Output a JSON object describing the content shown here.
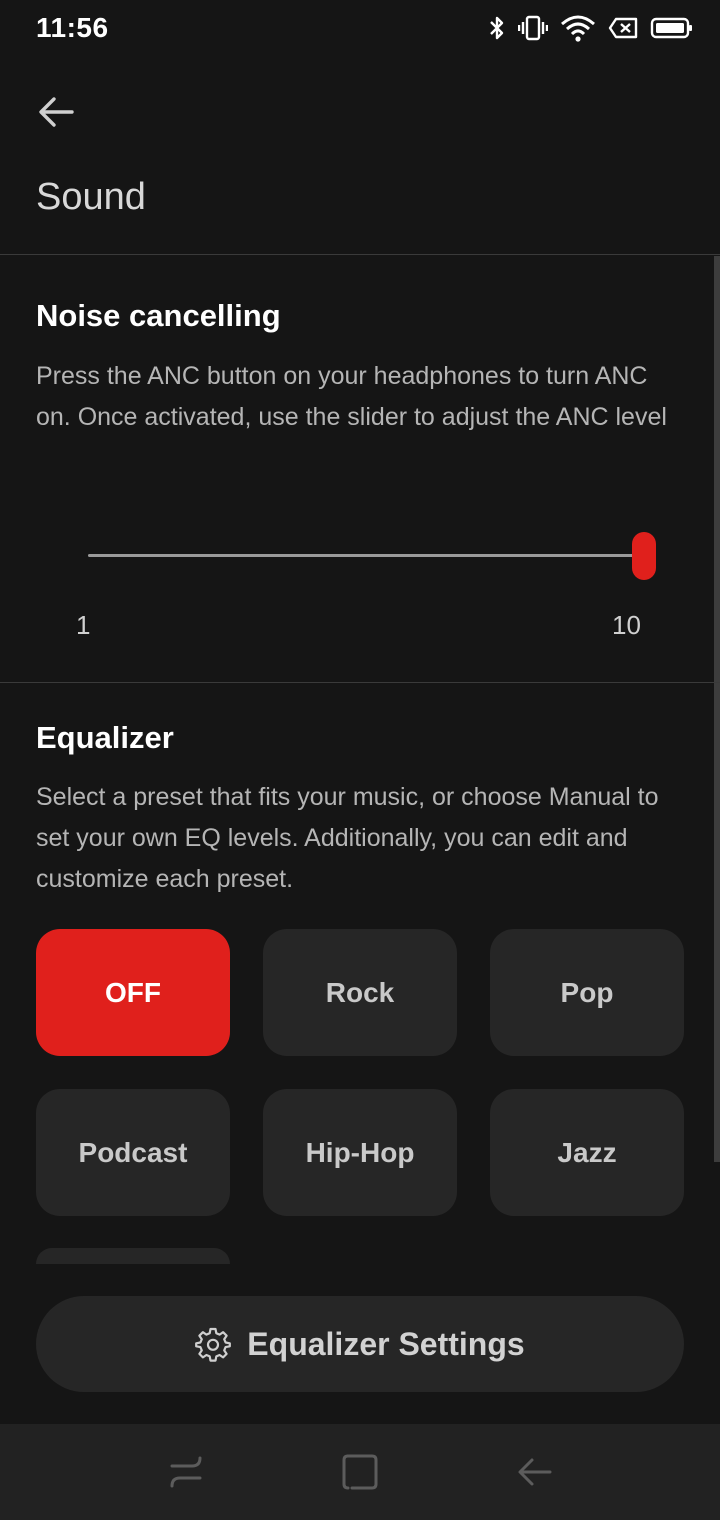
{
  "status_bar": {
    "time": "11:56",
    "icons": [
      "bluetooth-icon",
      "vibrate-icon",
      "wifi-icon",
      "no-sim-icon",
      "battery-icon"
    ]
  },
  "header": {
    "back_icon": "arrow-left-icon",
    "title": "Sound"
  },
  "noise_cancelling": {
    "title": "Noise cancelling",
    "description": "Press the ANC button on your headphones to turn ANC on. Once activated, use the slider to adjust the ANC level",
    "slider": {
      "min": 1,
      "max": 10,
      "value": 10,
      "min_label": "1",
      "max_label": "10"
    },
    "accent_color": "#e0201c"
  },
  "equalizer": {
    "title": "Equalizer",
    "description": "Select a preset that fits your music, or choose Manual to set your own EQ levels. Additionally, you can edit and customize each preset.",
    "presets": [
      {
        "label": "OFF",
        "active": true
      },
      {
        "label": "Rock",
        "active": false
      },
      {
        "label": "Pop",
        "active": false
      },
      {
        "label": "Podcast",
        "active": false
      },
      {
        "label": "Hip-Hop",
        "active": false
      },
      {
        "label": "Jazz",
        "active": false
      }
    ],
    "settings_button": {
      "label": "Equalizer Settings",
      "icon": "gear-icon"
    }
  },
  "nav_bar": {
    "buttons": [
      "recents-icon",
      "home-icon",
      "back-icon"
    ]
  }
}
